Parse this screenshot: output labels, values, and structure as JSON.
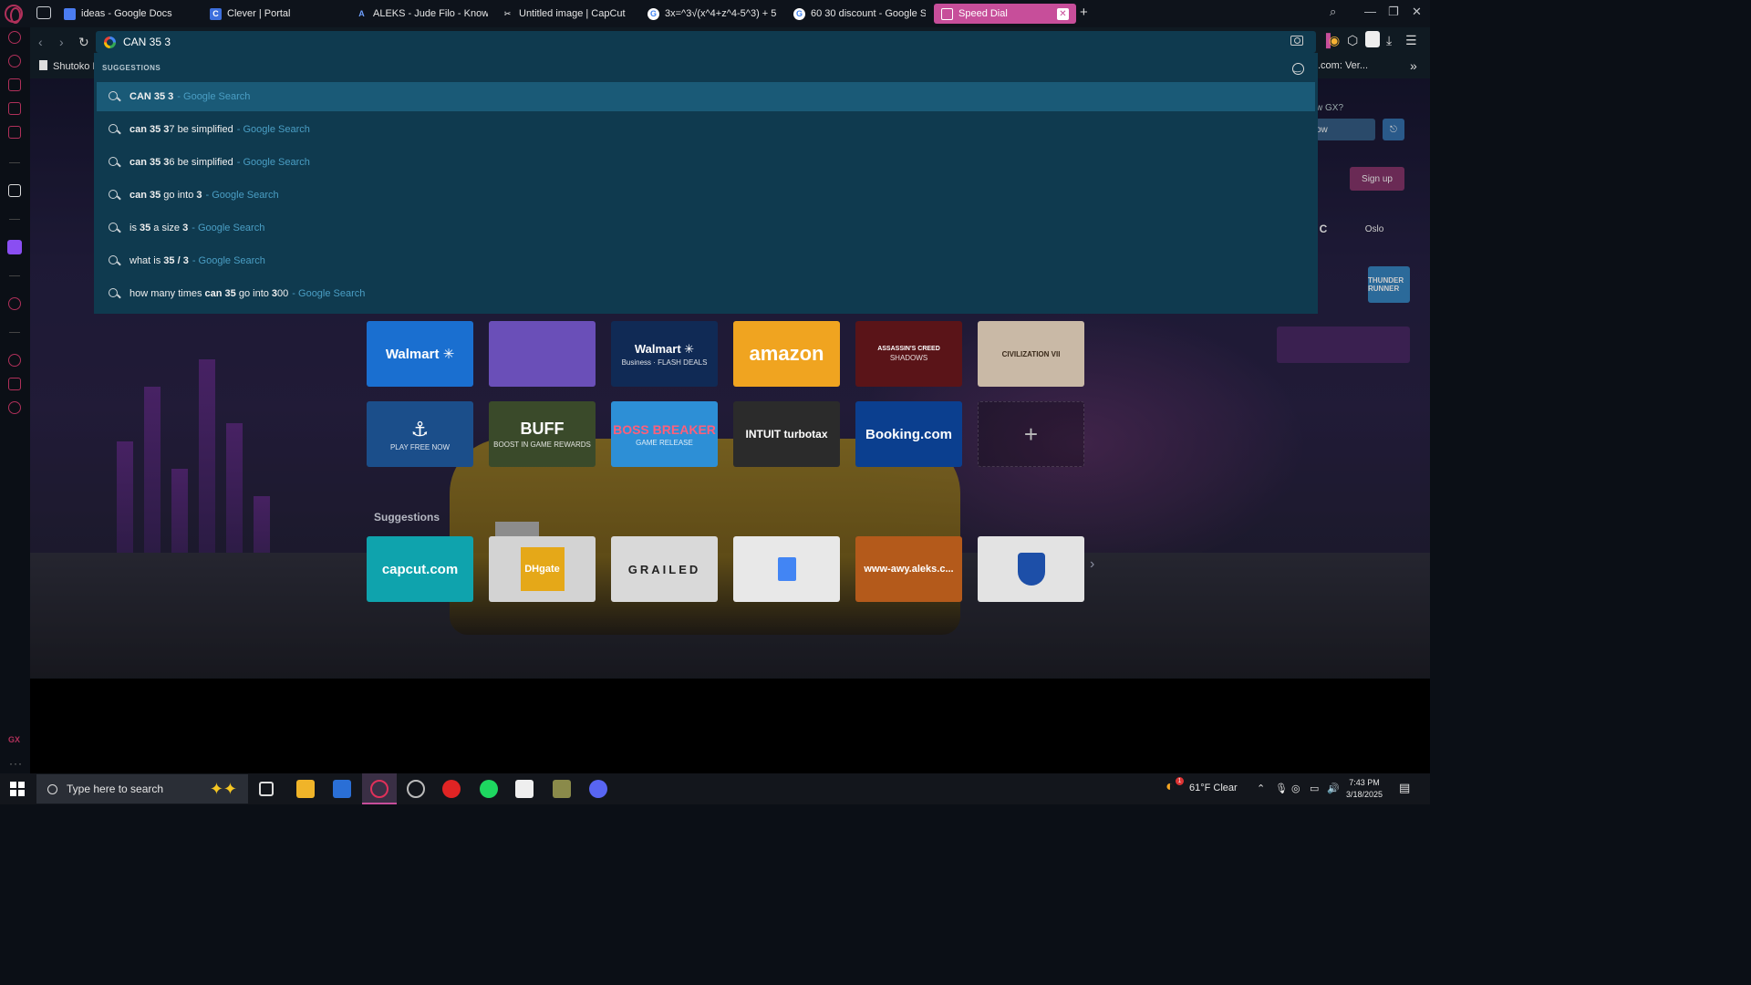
{
  "tabs": [
    {
      "label": "ideas - Google Docs",
      "favicon": "docs-icon",
      "color": "#4b7cf0"
    },
    {
      "label": "Clever | Portal",
      "favicon": "clever-icon",
      "color": "#3d6fdd"
    },
    {
      "label": "ALEKS - Jude Filo - Knowl",
      "favicon": "aleks-icon",
      "color": "#2a5caa"
    },
    {
      "label": "Untitled image | CapCut",
      "favicon": "capcut-icon",
      "color": "#ffffff"
    },
    {
      "label": "3x=^3√(x^4+z^4-5^3) + 5",
      "favicon": "google-icon",
      "color": "#ffffff"
    },
    {
      "label": "60 30 discount - Google S",
      "favicon": "google-icon",
      "color": "#ffffff"
    },
    {
      "label": "Speed Dial",
      "favicon": "speed-dial-icon",
      "color": "#c74e9a"
    }
  ],
  "active_tab_index": 6,
  "bookmarks": {
    "first": "Shutoko I",
    "right": ".com: Ver..."
  },
  "address": {
    "value": "CAN 35 3"
  },
  "suggestions": {
    "heading": "SUGGESTIONS",
    "items": [
      {
        "parts": [
          [
            "b",
            "CAN 35 3"
          ]
        ],
        "source": "- Google Search",
        "selected": true
      },
      {
        "parts": [
          [
            "b",
            "can 35 3"
          ],
          [
            "t",
            "7 be simplified"
          ]
        ],
        "source": "- Google Search"
      },
      {
        "parts": [
          [
            "b",
            "can 35 3"
          ],
          [
            "t",
            "6 be simplified"
          ]
        ],
        "source": "- Google Search"
      },
      {
        "parts": [
          [
            "b",
            "can 35"
          ],
          [
            "t",
            " go into "
          ],
          [
            "b",
            "3"
          ]
        ],
        "source": "- Google Search"
      },
      {
        "parts": [
          [
            "t",
            "is "
          ],
          [
            "b",
            "35"
          ],
          [
            "t",
            " a size "
          ],
          [
            "b",
            "3"
          ]
        ],
        "source": "- Google Search"
      },
      {
        "parts": [
          [
            "t",
            "what is "
          ],
          [
            "b",
            "35 / 3"
          ]
        ],
        "source": "- Google Search"
      },
      {
        "parts": [
          [
            "t",
            "how many times "
          ],
          [
            "b",
            "can 35"
          ],
          [
            "t",
            " go into "
          ],
          [
            "b",
            "3"
          ],
          [
            "t",
            "00"
          ]
        ],
        "source": "- Google Search"
      }
    ]
  },
  "speed_dial": {
    "row1": [
      {
        "title": "Walmart ✳",
        "sub": "",
        "bg": "#1a6fd0"
      },
      {
        "title": "",
        "sub": "",
        "bg": "#6a4fb8"
      },
      {
        "title": "Walmart ✳",
        "sub": "Business · FLASH DEALS",
        "bg": "#102a55"
      },
      {
        "title": "amazon",
        "sub": "",
        "bg": "#f0a420"
      },
      {
        "title": "ASSASSIN'S CREED",
        "sub": "SHADOWS",
        "bg": "#5a1418"
      },
      {
        "title": "CIVILIZATION VII",
        "sub": "",
        "bg": "#c9b9a6"
      }
    ],
    "row2": [
      {
        "title": "⚓",
        "sub": "PLAY FREE NOW",
        "bg": "#1b4e8a"
      },
      {
        "title": "BUFF",
        "sub": "BOOST IN GAME REWARDS",
        "bg": "#3a4a2a"
      },
      {
        "title": "BOSS BREAKER",
        "sub": "GAME RELEASE",
        "bg": "#2d8fd6"
      },
      {
        "title": "INTUIT turbotax",
        "sub": "",
        "bg": "#2b2b2b"
      },
      {
        "title": "Booking.com",
        "sub": "",
        "bg": "#0b3f8f"
      },
      {
        "title": "+",
        "sub": "",
        "bg": ""
      }
    ],
    "suggestions_heading": "Suggestions",
    "suggestions": [
      {
        "title": "capcut.com",
        "bg": "#0fa3ad"
      },
      {
        "title": "DHgate",
        "bg": "#d3d3d3"
      },
      {
        "title": "GRAILED",
        "bg": "#d9d9d9"
      },
      {
        "title": "",
        "bg": "#e8e8e8"
      },
      {
        "title": "www-awy.aleks.c...",
        "bg": "#b45a1b"
      },
      {
        "title": "",
        "bg": "#e3e3e3"
      }
    ]
  },
  "right_peek": {
    "gx_question": "w GX?",
    "now": "ow",
    "signup": "Sign up",
    "c": "C",
    "oslo": "Oslo",
    "thunder": "THUNDER RUNNER"
  },
  "taskbar": {
    "search_placeholder": "Type here to search",
    "weather": "61°F  Clear",
    "weather_badge": "1",
    "time": "7:43 PM",
    "date": "3/18/2025"
  },
  "sidebar_label": "GX",
  "colors": {
    "accent": "#c74e9a",
    "dropdown_bg": "#0f3a4f",
    "selected_row": "#1a5a77",
    "source_link": "#4a9ec4"
  }
}
